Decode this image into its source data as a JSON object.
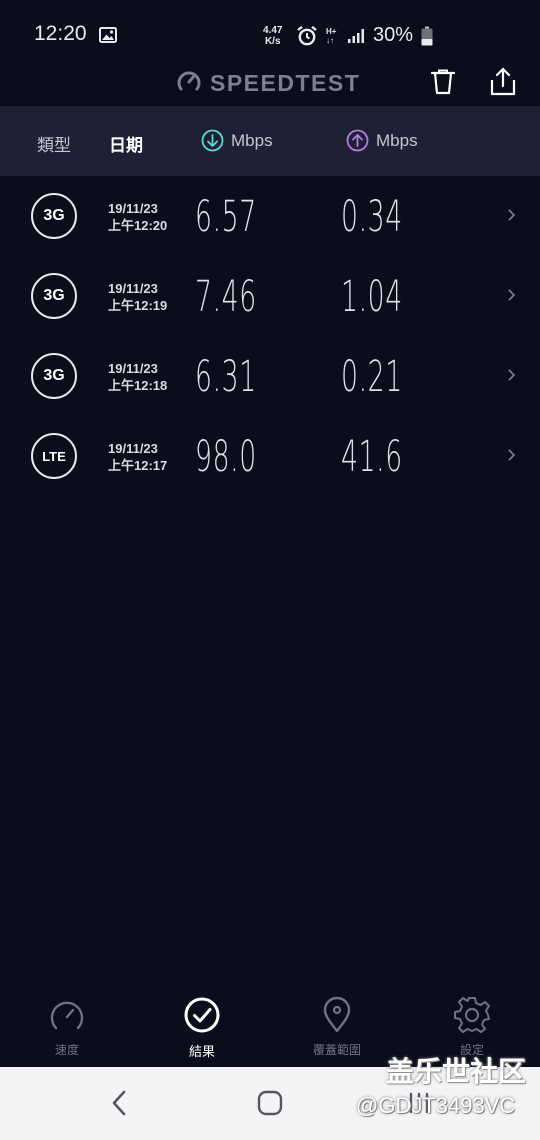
{
  "status_bar": {
    "time": "12:20",
    "net_speed_value": "4.47",
    "net_speed_unit": "K/s",
    "network_type": "H+",
    "battery": "30%"
  },
  "header": {
    "logo_text": "SPEEDTEST"
  },
  "columns": {
    "type": "類型",
    "date": "日期",
    "download_unit": "Mbps",
    "upload_unit": "Mbps"
  },
  "results": [
    {
      "type": "3G",
      "date": "19/11/23",
      "time": "上午12:20",
      "download": "6.57",
      "upload": "0.34"
    },
    {
      "type": "3G",
      "date": "19/11/23",
      "time": "上午12:19",
      "download": "7.46",
      "upload": "1.04"
    },
    {
      "type": "3G",
      "date": "19/11/23",
      "time": "上午12:18",
      "download": "6.31",
      "upload": "0.21"
    },
    {
      "type": "LTE",
      "date": "19/11/23",
      "time": "上午12:17",
      "download": "98.0",
      "upload": "41.6"
    }
  ],
  "bottom_nav": [
    {
      "label": "速度",
      "icon": "speedometer-icon",
      "active": false
    },
    {
      "label": "結果",
      "icon": "check-circle-icon",
      "active": true
    },
    {
      "label": "覆蓋範圍",
      "icon": "location-pin-icon",
      "active": false
    },
    {
      "label": "設定",
      "icon": "gear-icon",
      "active": false
    }
  ],
  "watermark": {
    "line1": "盖乐世社区",
    "line2": "@GDJT3493VC"
  },
  "colors": {
    "background": "#0b0d1c",
    "header_bar": "#1d2133",
    "download_accent": "#5fd6d3",
    "upload_accent": "#b67ae0"
  }
}
